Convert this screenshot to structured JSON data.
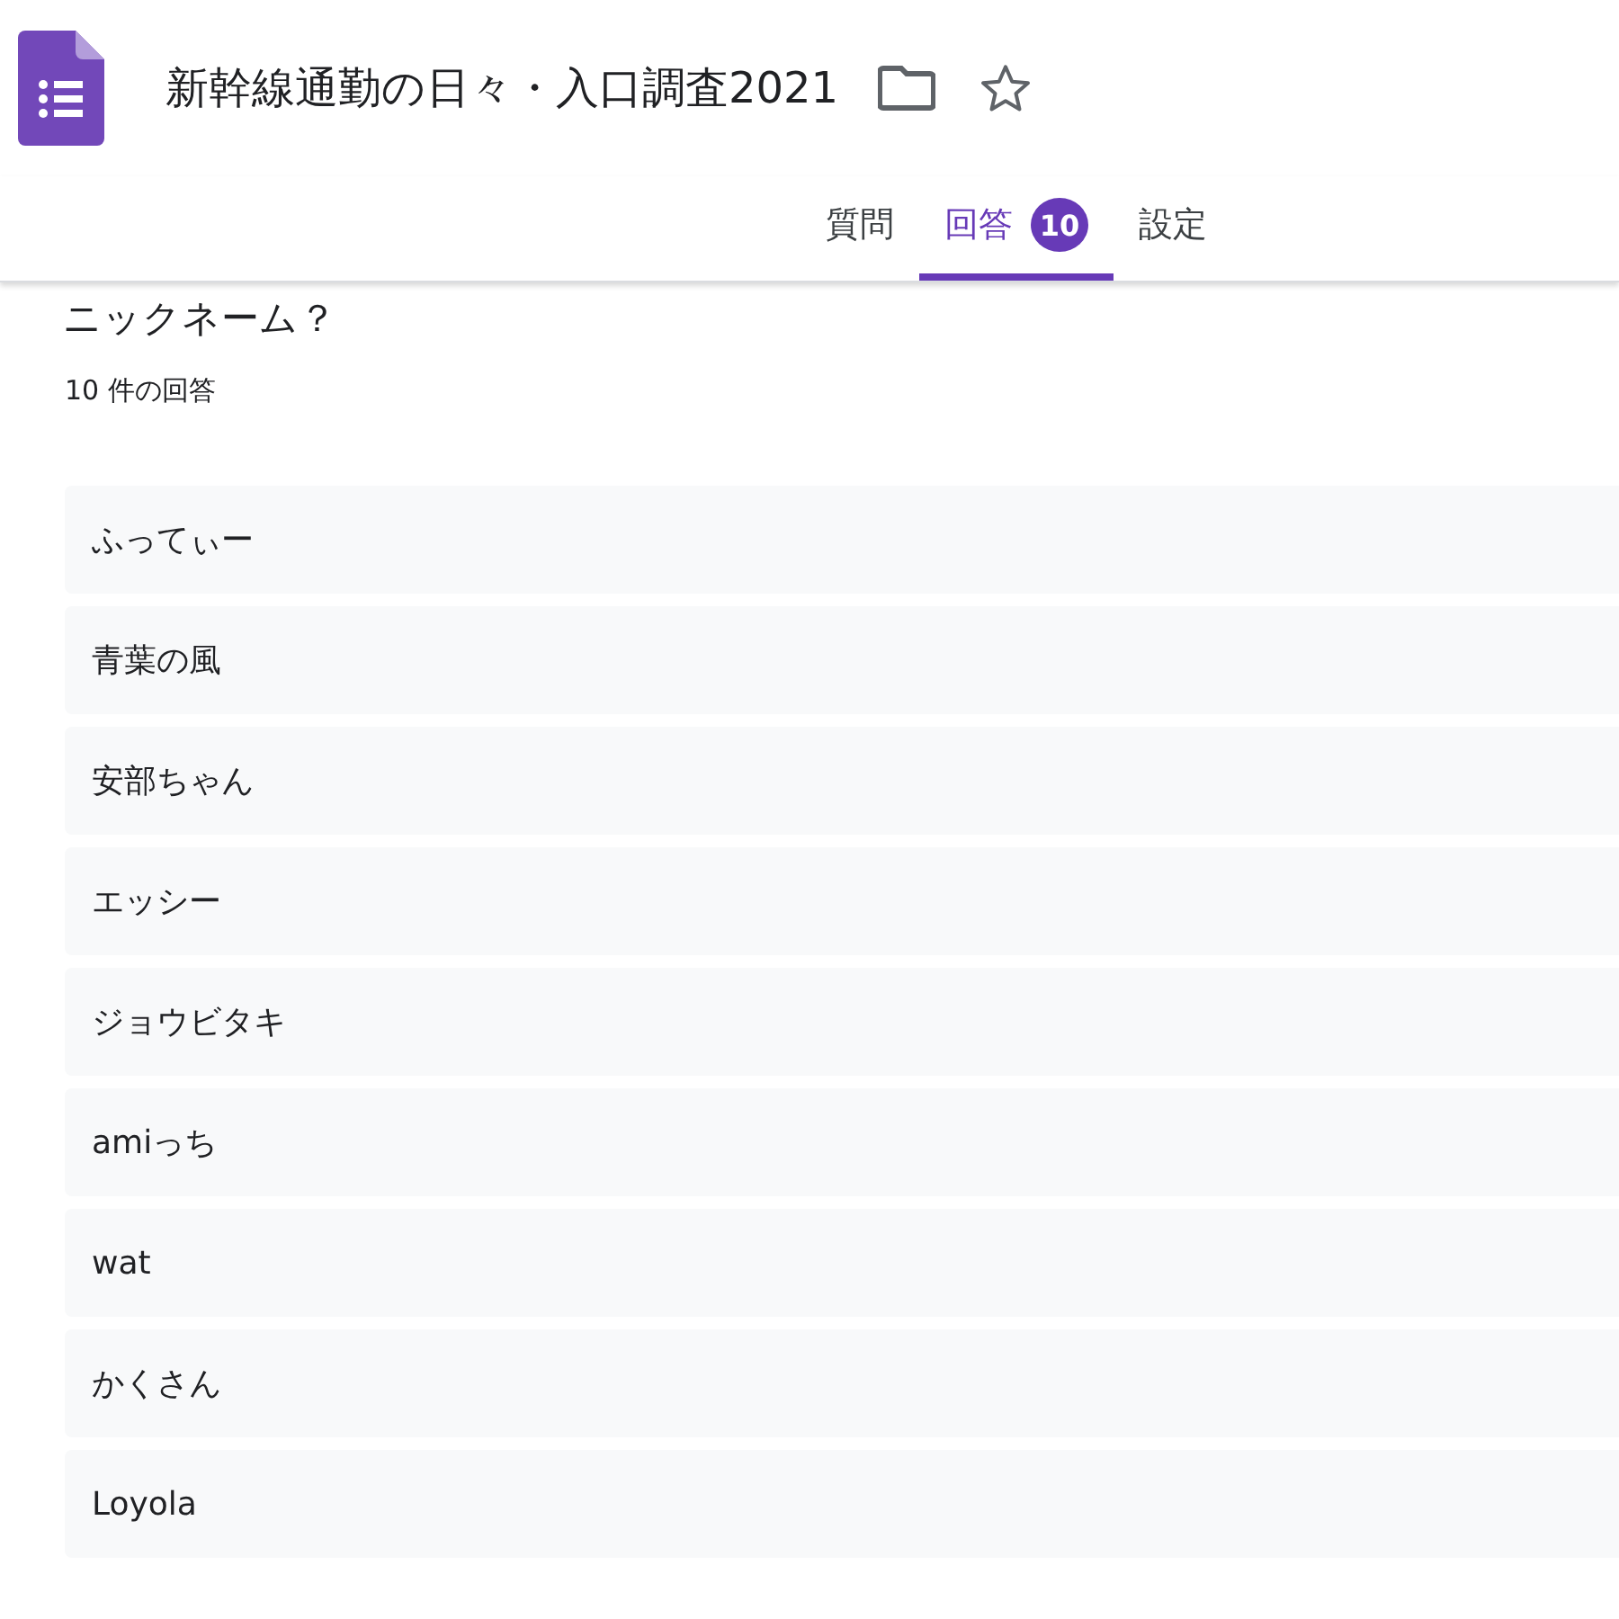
{
  "header": {
    "title": "新幹線通勤の日々・入口調査2021",
    "starred": false
  },
  "tabs": [
    {
      "label": "質問",
      "selected": false
    },
    {
      "label": "回答",
      "selected": true,
      "badge": "10"
    },
    {
      "label": "設定",
      "selected": false
    }
  ],
  "question": {
    "title": "ニックネーム？",
    "count": "10 件の回答"
  },
  "responses": [
    "ふってぃー",
    "青葉の風",
    "安部ちゃん",
    "エッシー",
    "ジョウビタキ",
    "amiっち",
    "wat",
    "かくさん",
    "Loyola"
  ]
}
